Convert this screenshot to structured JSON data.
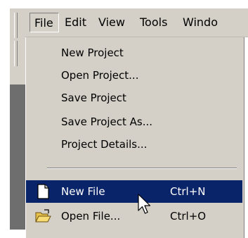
{
  "menubar": {
    "menus": [
      "File",
      "Edit",
      "View",
      "Tools",
      "Windo"
    ]
  },
  "file_menu": {
    "items": [
      {
        "label": "New Project"
      },
      {
        "label": "Open Project..."
      },
      {
        "label": "Save Project"
      },
      {
        "label": "Save Project As..."
      },
      {
        "label": "Project Details..."
      },
      {
        "label": "New File",
        "shortcut": "Ctrl+N",
        "icon": "new-file-icon",
        "selected": true
      },
      {
        "label": "Open File...",
        "shortcut": "Ctrl+O",
        "icon": "open-folder-icon"
      }
    ]
  },
  "colors": {
    "menu_background": "#d4d0c8",
    "selection_highlight": "#0a246a",
    "selected_text": "#ffffff"
  }
}
